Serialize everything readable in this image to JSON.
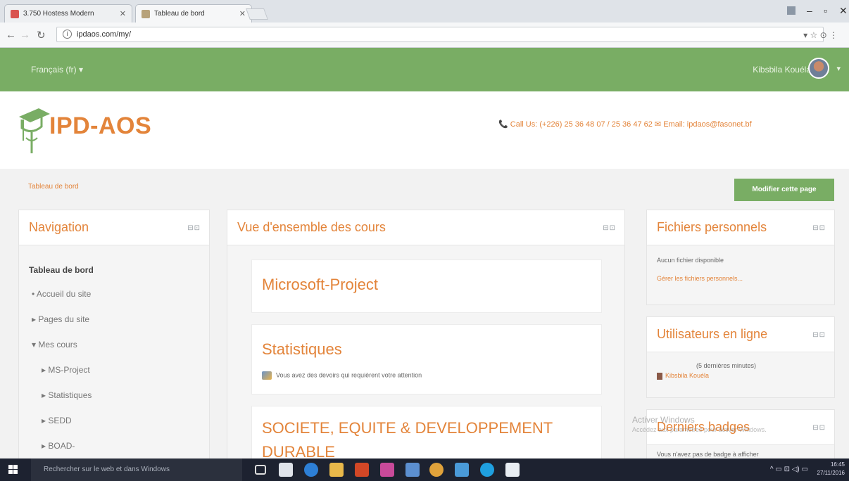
{
  "browser": {
    "tabs": [
      {
        "label": "3.750 Hostess Modern"
      },
      {
        "label": "Tableau de bord"
      }
    ],
    "url": "ipdaos.com/my/"
  },
  "topbar": {
    "language": "Français (fr) ▾",
    "user_name": "Kibsbila Kouéla"
  },
  "header": {
    "logo": "IPD-AOS",
    "contact": "📞 Call Us: (+226) 25 36 48 07 / 25 36 47 62  ✉ Email: ipdaos@fasonet.bf"
  },
  "breadcrumb": "Tableau de bord",
  "edit_button": "Modifier cette page",
  "navigation": {
    "title": "Navigation",
    "items": [
      {
        "label": "Tableau de bord"
      },
      {
        "label": "• Accueil du site"
      },
      {
        "label": "▸ Pages du site"
      },
      {
        "label": "▾ Mes cours"
      },
      {
        "label": "▸ MS-Project"
      },
      {
        "label": "▸ Statistiques"
      },
      {
        "label": "▸ SEDD"
      },
      {
        "label": "▸ BOAD-"
      }
    ]
  },
  "overview": {
    "title": "Vue d'ensemble des cours",
    "courses": [
      {
        "name": "Microsoft-Project",
        "note": ""
      },
      {
        "name": "Statistiques",
        "note": "Vous avez des devoirs qui requièrent votre attention"
      },
      {
        "name": "SOCIETE, EQUITE & DEVELOPPEMENT",
        "name2": "DURABLE"
      }
    ]
  },
  "files": {
    "title": "Fichiers personnels",
    "empty": "Aucun fichier disponible",
    "manage": "Gérer les fichiers personnels..."
  },
  "online": {
    "title": "Utilisateurs en ligne",
    "period": "(5 dernières minutes)",
    "user": "Kibsbila Kouéla"
  },
  "badges": {
    "title": "Derniers badges",
    "text": "Vous n'avez pas de badge à afficher"
  },
  "watermark": {
    "line1": "Activer Windows",
    "line2": "Accédez aux paramètres pour activer Windows."
  },
  "taskbar": {
    "search": "Rechercher sur le web et dans Windows",
    "time": "16:45",
    "date": "27/11/2016"
  }
}
